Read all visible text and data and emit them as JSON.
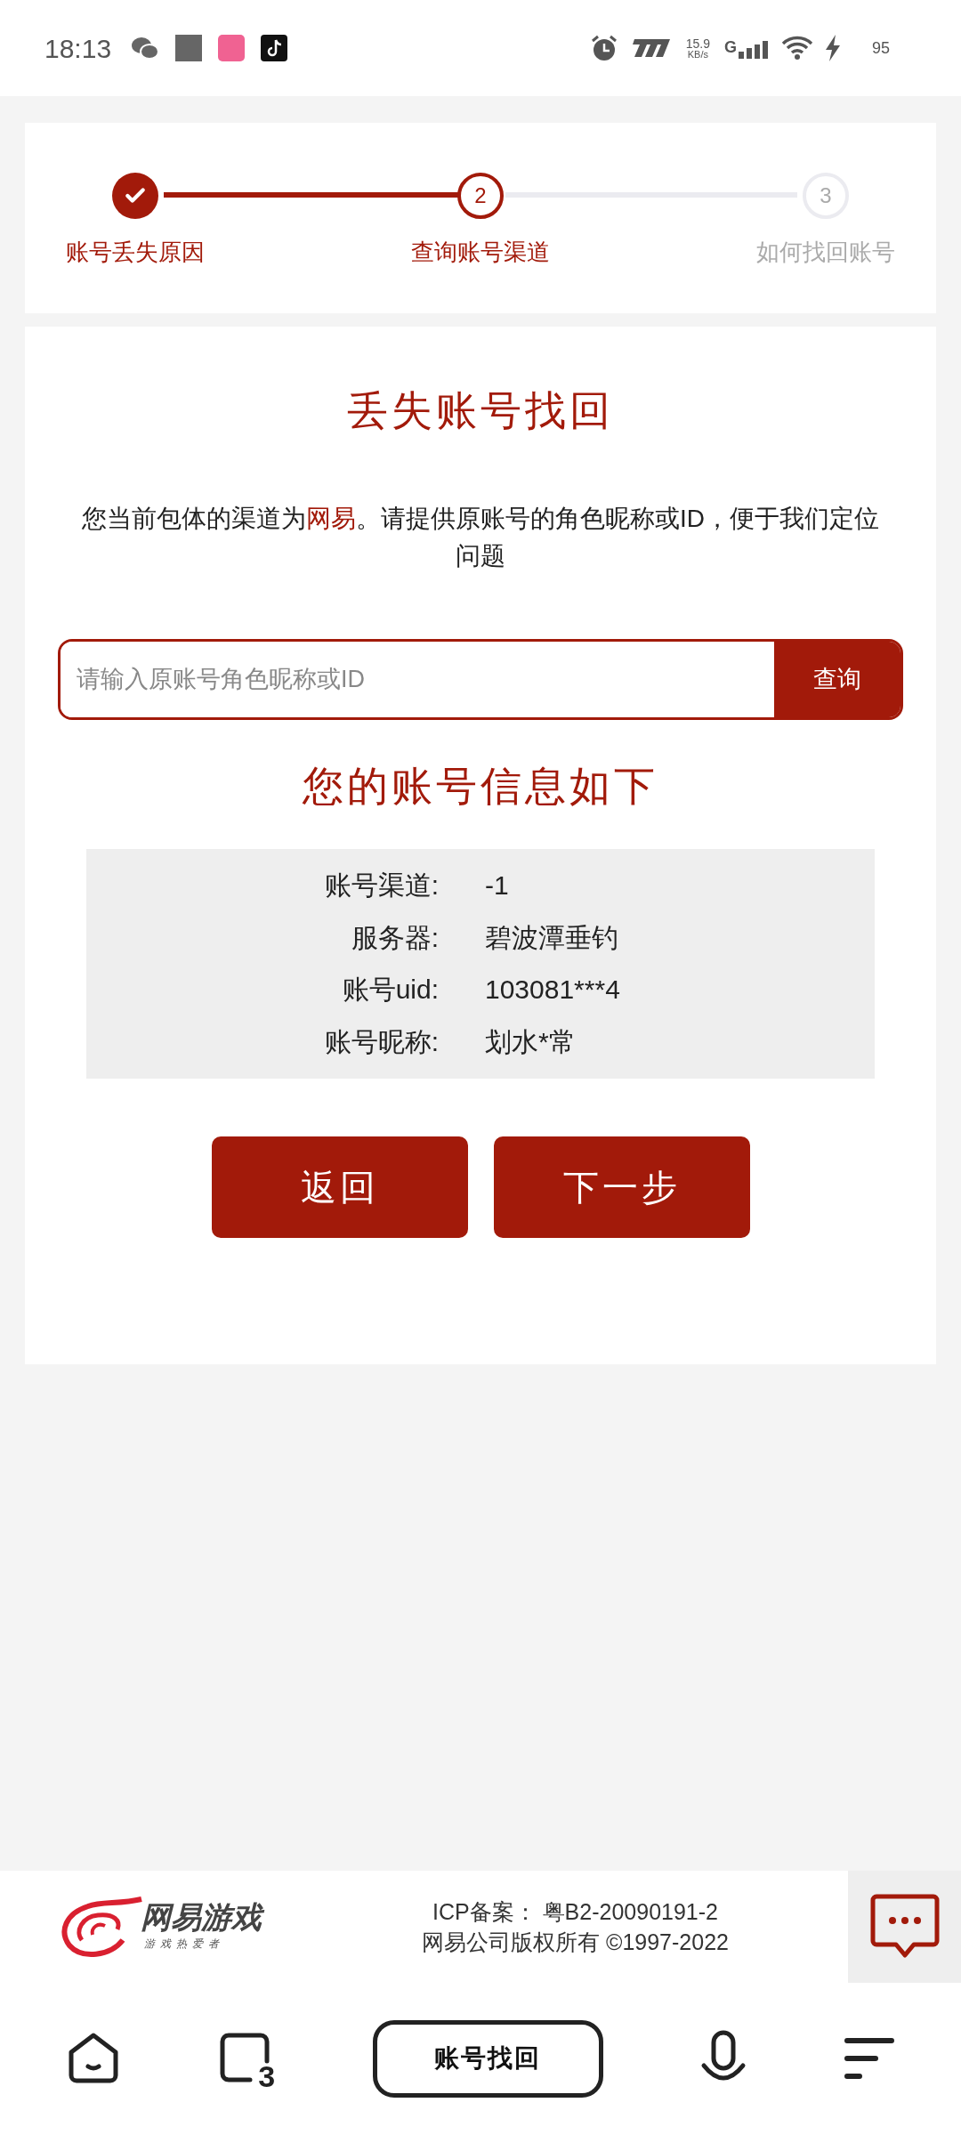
{
  "status_bar": {
    "time": "18:13",
    "net_speed": "15.9",
    "net_unit": "KB/s",
    "network": "G",
    "battery": "95"
  },
  "steps": [
    {
      "label": "账号丢失原因",
      "kind": "done"
    },
    {
      "number": "2",
      "label": "查询账号渠道",
      "kind": "current"
    },
    {
      "number": "3",
      "label": "如何找回账号",
      "kind": "todo"
    }
  ],
  "title": "丢失账号找回",
  "intro": [
    {
      "text": "您当前包体的渠道为",
      "highlight": false
    },
    {
      "text": "网易",
      "highlight": true
    },
    {
      "text": "。请提供原账号的角色昵称或ID，便于我们定位问题",
      "highlight": false
    }
  ],
  "search": {
    "placeholder": "请输入原账号角色昵称或ID",
    "button": "查询"
  },
  "info_heading": "您的账号信息如下",
  "info": [
    {
      "label": "账号渠道:",
      "value": "-1"
    },
    {
      "label": "服务器:",
      "value": "碧波潭垂钓"
    },
    {
      "label": "账号uid:",
      "value": "103081***4"
    },
    {
      "label": "账号昵称:",
      "value": "划水*常"
    }
  ],
  "buttons": [
    "返回",
    "下一步"
  ],
  "footer": {
    "logo_name": "网易游戏",
    "logo_tagline": "游戏热爱者",
    "icp": "ICP备案： 粤B2-20090191-2",
    "copyright": "网易公司版权所有 ©1997-2022"
  },
  "nav": {
    "tab_count": "3",
    "title": "账号找回"
  }
}
